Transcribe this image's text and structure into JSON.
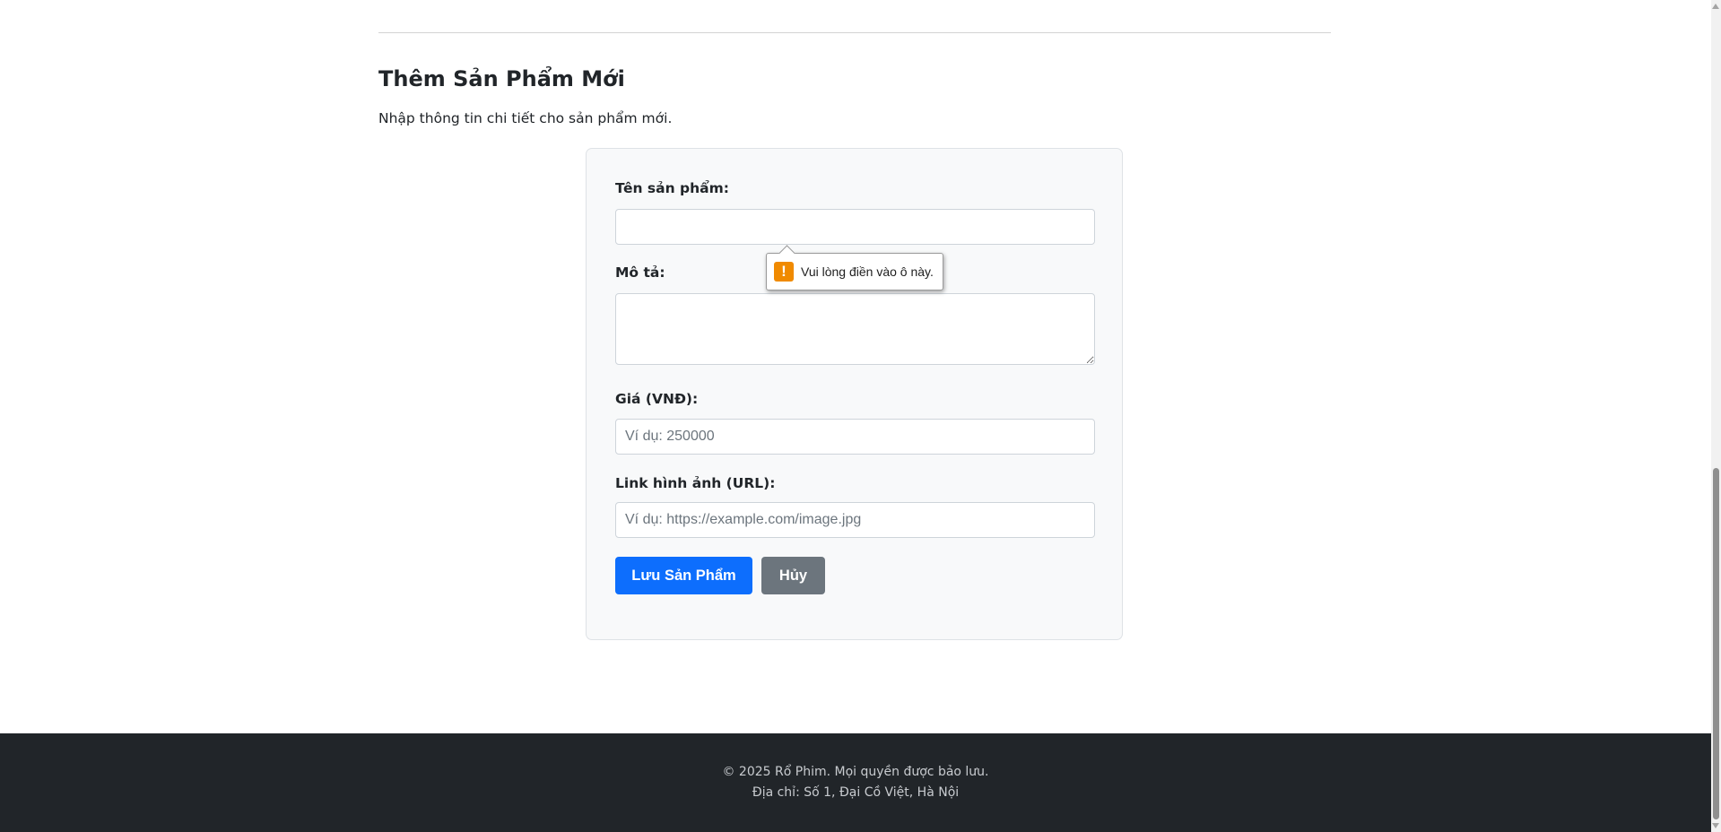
{
  "page": {
    "title": "Thêm Sản Phẩm Mới",
    "subtitle": "Nhập thông tin chi tiết cho sản phẩm mới."
  },
  "form": {
    "name_label": "Tên sản phẩm:",
    "name_value": "",
    "description_label": "Mô tả:",
    "description_value": "",
    "price_label": "Giá (VNĐ):",
    "price_placeholder": "Ví dụ: 250000",
    "image_label": "Link hình ảnh (URL):",
    "image_placeholder": "Ví dụ: https://example.com/image.jpg",
    "save_label": "Lưu Sản Phẩm",
    "cancel_label": "Hủy"
  },
  "validation_tooltip": {
    "icon": "warning-icon",
    "icon_glyph": "!",
    "message": "Vui lòng điền vào ô này."
  },
  "footer": {
    "copyright": "© 2025 Rổ Phim. Mọi quyền được bảo lưu.",
    "address": "Địa chỉ: Số 1, Đại Cồ Việt, Hà Nội"
  },
  "colors": {
    "primary": "#0d6efd",
    "secondary": "#6c757d",
    "footer_bg": "#212529",
    "warning": "#f08a00"
  }
}
